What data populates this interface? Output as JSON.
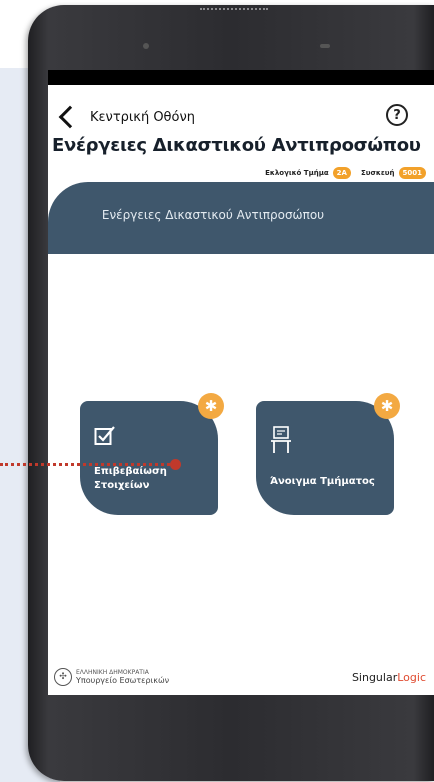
{
  "header": {
    "back_label": "Κεντρική Οθόνη",
    "help_glyph": "?",
    "title": "Ενέργειες Δικαστικού Αντιπροσώπου",
    "section_label": "Εκλογικό Τμήμα",
    "section_value": "2A",
    "device_label": "Συσκευή",
    "device_value": "5001"
  },
  "banner": {
    "text": "Ενέργειες Δικαστικού Αντιπροσώπου"
  },
  "tiles": [
    {
      "label_line1": "Επιβεβαίωση",
      "label_line2": "Στοιχείων",
      "icon": "checkbox-icon"
    },
    {
      "label_line1": "Άνοιγμα Τμήματος",
      "icon": "ballot-box-icon"
    }
  ],
  "footer": {
    "ministry_line1": "ΕΛΛΗΝΙΚΗ ΔΗΜΟΚΡΑΤΙΑ",
    "ministry_line2": "Υπουργείο Εσωτερικών",
    "brand_main": "Singular",
    "brand_accent": "Logic"
  },
  "navbar": {
    "back": "◁",
    "home": "○",
    "recent": "□"
  },
  "colors": {
    "tile": "#3f576c",
    "accent": "#f3a942",
    "annotation": "#c0392b"
  }
}
